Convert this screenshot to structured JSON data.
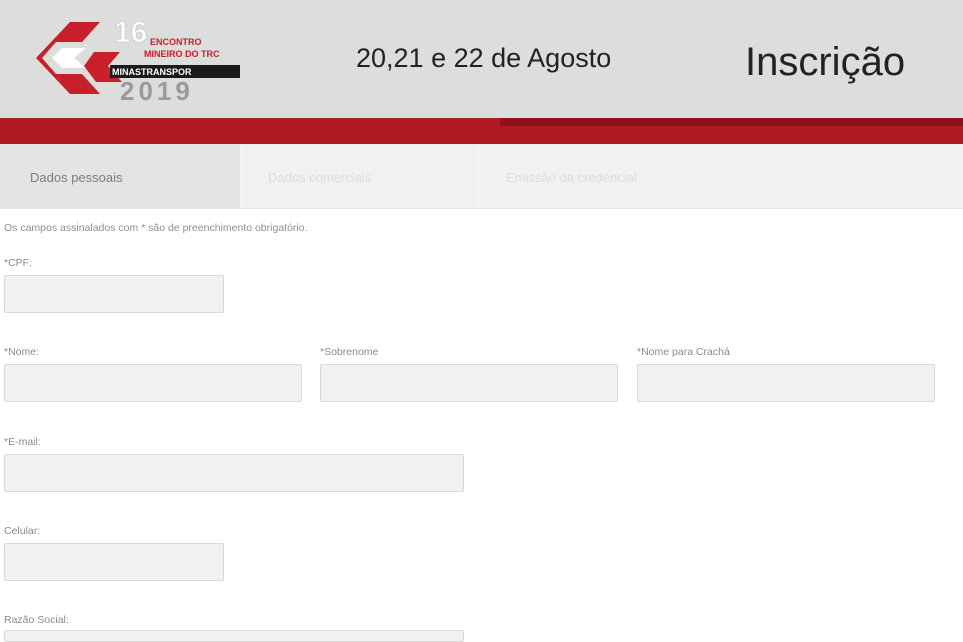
{
  "header": {
    "logo_number": "16",
    "logo_line1": "ENCONTRO",
    "logo_line2": "MINEIRO DO TRC",
    "logo_line3": "MINASTRANSPOR",
    "logo_year": "2019",
    "dates": "20,21 e 22 de Agosto",
    "title": "Inscrição",
    "colors": {
      "brand_red": "#b01a22",
      "header_bg": "#dcdedb"
    }
  },
  "tabs": [
    {
      "label": "Dados pessoais",
      "state": "active"
    },
    {
      "label": "Dados comerciais",
      "state": "disabled"
    },
    {
      "label": "Emissão da credencial",
      "state": "disabled"
    }
  ],
  "form": {
    "required_note": "Os campos assinalados com * são de preenchimento obrigatório.",
    "cpf": {
      "label": "*CPF:",
      "value": ""
    },
    "nome": {
      "label": "*Nome:",
      "value": ""
    },
    "sobrenome": {
      "label": "*Sobrenome",
      "value": ""
    },
    "cracha": {
      "label": "*Nome para Crachá",
      "value": ""
    },
    "email": {
      "label": "*E-mail:",
      "value": ""
    },
    "celular": {
      "label": "Celular:",
      "value": ""
    },
    "razao_social": {
      "label": "Razão Social:",
      "value": ""
    }
  }
}
